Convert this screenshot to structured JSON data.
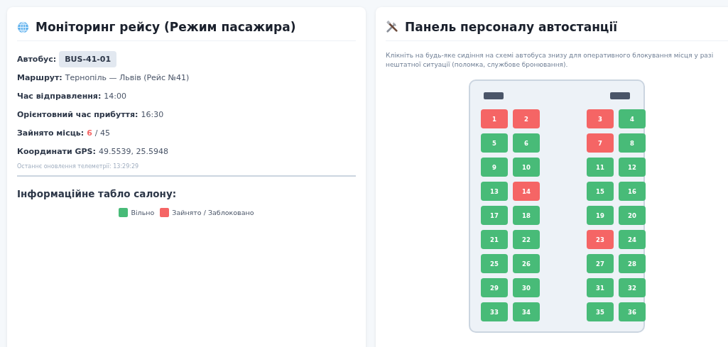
{
  "passenger_panel": {
    "title": "Моніторинг рейсу (Режим пасажира)",
    "bus": {
      "label": "Автобус:",
      "value": "BUS-41-01"
    },
    "fields": [
      {
        "label": "Маршрут:",
        "value": "Тернопіль — Львів (Рейс №41)"
      },
      {
        "label": "Час відправлення:",
        "value": "14:00"
      },
      {
        "label": "Орієнтовний час прибуття:",
        "value": "16:30"
      },
      {
        "label": "Координати GPS:",
        "value": "49.5539, 25.5948"
      }
    ],
    "occupancy": {
      "label": "Зайнято місць:",
      "taken": "6",
      "total": "/ 45"
    },
    "telemetry": "Останнє оновлення телеметрії: 13:29:29",
    "board_title": "Інформаційне табло салону:",
    "legend": [
      {
        "label": "Вільно",
        "color": "#48bb78"
      },
      {
        "label": "Зайнято / Заблоковано",
        "color": "#f56565"
      }
    ]
  },
  "staff_panel": {
    "title": "Панель персоналу автостанції",
    "hint": "Клікніть на будь-яке сидіння на схемі автобуса знизу для оперативного блокування місця у разі нештатної ситуації (поломка, службове бронювання).",
    "seats": [
      {
        "number": "1",
        "occupied": true
      },
      {
        "number": "2",
        "occupied": true
      },
      {
        "number": "3",
        "occupied": true
      },
      {
        "number": "4",
        "occupied": false
      },
      {
        "number": "5",
        "occupied": false
      },
      {
        "number": "6",
        "occupied": false
      },
      {
        "number": "7",
        "occupied": true
      },
      {
        "number": "8",
        "occupied": false
      },
      {
        "number": "9",
        "occupied": false
      },
      {
        "number": "10",
        "occupied": false
      },
      {
        "number": "11",
        "occupied": false
      },
      {
        "number": "12",
        "occupied": false
      },
      {
        "number": "13",
        "occupied": false
      },
      {
        "number": "14",
        "occupied": true
      },
      {
        "number": "15",
        "occupied": false
      },
      {
        "number": "16",
        "occupied": false
      },
      {
        "number": "17",
        "occupied": false
      },
      {
        "number": "18",
        "occupied": false
      },
      {
        "number": "19",
        "occupied": false
      },
      {
        "number": "20",
        "occupied": false
      },
      {
        "number": "21",
        "occupied": false
      },
      {
        "number": "22",
        "occupied": false
      },
      {
        "number": "23",
        "occupied": true
      },
      {
        "number": "24",
        "occupied": false
      },
      {
        "number": "25",
        "occupied": false
      },
      {
        "number": "26",
        "occupied": false
      },
      {
        "number": "27",
        "occupied": false
      },
      {
        "number": "28",
        "occupied": false
      },
      {
        "number": "29",
        "occupied": false
      },
      {
        "number": "30",
        "occupied": false
      },
      {
        "number": "31",
        "occupied": false
      },
      {
        "number": "32",
        "occupied": false
      },
      {
        "number": "33",
        "occupied": false
      },
      {
        "number": "34",
        "occupied": false
      },
      {
        "number": "35",
        "occupied": false
      },
      {
        "number": "36",
        "occupied": false
      }
    ]
  }
}
